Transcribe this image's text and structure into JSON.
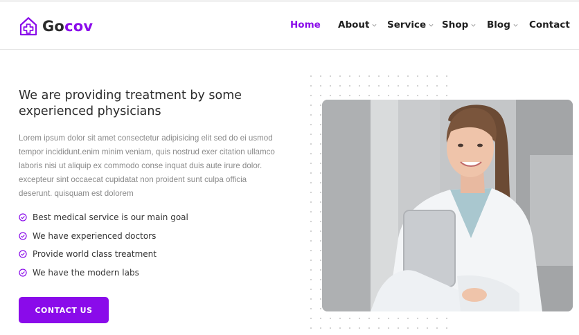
{
  "brand": {
    "name_part1": "Go",
    "name_part2": "cov",
    "accent_color": "#8a0bea",
    "icon": "house-medical-icon"
  },
  "nav": {
    "items": [
      {
        "label": "Home",
        "active": true,
        "has_dropdown": false
      },
      {
        "label": "About",
        "active": false,
        "has_dropdown": true
      },
      {
        "label": "Service",
        "active": false,
        "has_dropdown": true
      },
      {
        "label": "Shop",
        "active": false,
        "has_dropdown": true
      },
      {
        "label": "Blog",
        "active": false,
        "has_dropdown": true
      },
      {
        "label": "Contact",
        "active": false,
        "has_dropdown": false
      }
    ]
  },
  "hero": {
    "headline": "We are providing treatment by some experienced physicians",
    "paragraph": "Lorem ipsum dolor sit amet consectetur adipisicing elit sed do ei usmod tempor incididunt.enim minim veniam, quis nostrud exer citation ullamco laboris nisi ut aliquip ex commodo conse inquat duis aute irure dolor. excepteur sint occaecat cupidatat non proident sunt culpa officia deserunt. quisquam est dolorem",
    "features": [
      "Best medical service is our main goal",
      "We have experienced doctors",
      "Provide world class treatment",
      "We have the modern labs"
    ],
    "cta_label": "CONTACT US"
  },
  "colors": {
    "primary": "#8a0bea",
    "text_dark": "#2b2b2b",
    "text_muted": "#8a8a8a"
  }
}
